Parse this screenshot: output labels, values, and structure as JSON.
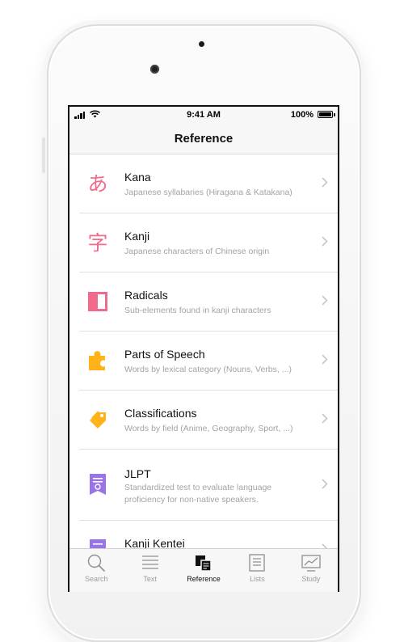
{
  "status_bar": {
    "time": "9:41 AM",
    "battery": "100%"
  },
  "nav": {
    "title": "Reference"
  },
  "items": [
    {
      "title": "Kana",
      "subtitle": "Japanese syllabaries (Hiragana & Katakana)",
      "icon": "hiragana-a-icon",
      "glyph": "あ"
    },
    {
      "title": "Kanji",
      "subtitle": "Japanese characters of Chinese origin",
      "icon": "kanji-character-icon",
      "glyph": "字"
    },
    {
      "title": "Radicals",
      "subtitle": "Sub-elements found in kanji characters",
      "icon": "radical-block-icon"
    },
    {
      "title": "Parts of Speech",
      "subtitle": "Words by lexical category (Nouns, Verbs, ...)",
      "icon": "puzzle-piece-icon"
    },
    {
      "title": "Classifications",
      "subtitle": "Words by field (Anime, Geography, Sport, ...)",
      "icon": "tag-icon"
    },
    {
      "title": "JLPT",
      "subtitle": "Standardized test to evaluate language proficiency for non-native speakers.",
      "icon": "certificate-icon"
    },
    {
      "title": "Kanji Kentei",
      "subtitle": "",
      "icon": "certificate-icon"
    }
  ],
  "tabs": [
    {
      "label": "Search",
      "icon": "magnifier-icon"
    },
    {
      "label": "Text",
      "icon": "text-lines-icon"
    },
    {
      "label": "Reference",
      "icon": "reference-cards-icon",
      "active": true
    },
    {
      "label": "Lists",
      "icon": "list-card-icon"
    },
    {
      "label": "Study",
      "icon": "chart-screen-icon"
    }
  ],
  "colors": {
    "pink": "#f06a8b",
    "orange": "#ffb21a",
    "purple": "#9b73e8",
    "chevron": "#c7c7cc"
  }
}
